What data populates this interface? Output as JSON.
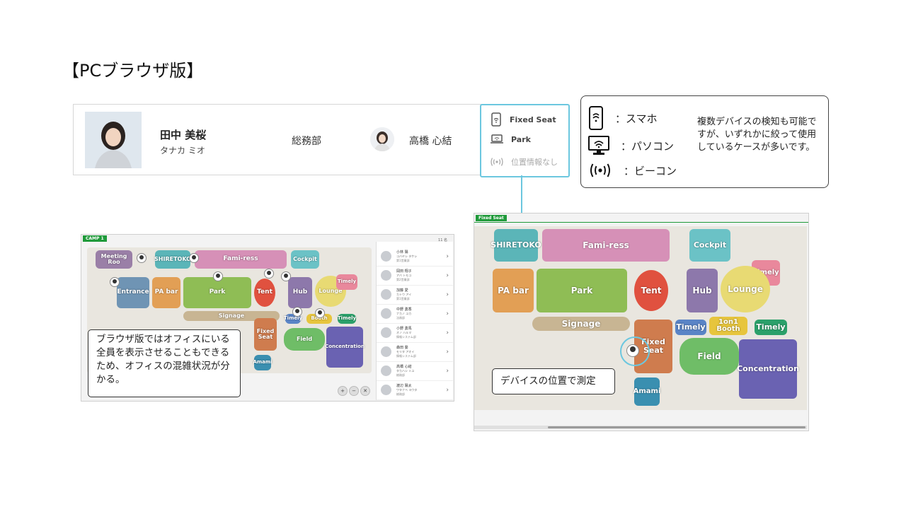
{
  "slide": {
    "title": "【PCブラウザ版】"
  },
  "profile": {
    "name": "田中 美桜",
    "kana": "タナカ ミオ",
    "department": "総務部",
    "colleague": "高橋 心結"
  },
  "status_legend": [
    {
      "icon": "smartphone-wifi-icon",
      "label": "Fixed Seat"
    },
    {
      "icon": "laptop-wifi-icon",
      "label": "Park"
    },
    {
      "icon": "beacon-icon",
      "label": "位置情報なし"
    }
  ],
  "device_legend": {
    "items": [
      {
        "icon": "smartphone-icon",
        "label": "：スマホ"
      },
      {
        "icon": "monitor-icon",
        "label": "：パソコン"
      },
      {
        "icon": "beacon-icon",
        "label": "：ビーコン"
      }
    ],
    "note": "複数デバイスの検知も可能ですが、いずれかに絞って使用しているケースが多いです。"
  },
  "left_map": {
    "tag": "CAMP 1",
    "zones": [
      "Meeting Roo",
      "SHIRETOKO",
      "Fami-ress",
      "Cockpit",
      "Entrance",
      "PA bar",
      "Park",
      "Tent",
      "Hub",
      "Lounge",
      "Timely",
      "Signage",
      "Timely",
      "Booth",
      "Timely",
      "Fixed Seat",
      "Field",
      "Concentration",
      "Amami"
    ],
    "list_header": "11 名",
    "people": [
      {
        "name": "小林 陽",
        "kana": "コバヤシ タケシ",
        "dept": "第1営業部"
      },
      {
        "name": "岡田 翔子",
        "kana": "アバ トモコ",
        "dept": "第2営業部"
      },
      {
        "name": "加藤 愛",
        "kana": "カトウ アイ",
        "dept": "第1営業部"
      },
      {
        "name": "中野 勇香",
        "kana": "ナカノ ユカ",
        "dept": "法務部"
      },
      {
        "name": "小野 勇馬",
        "kana": "オノ ハルマ",
        "dept": "情報システム部"
      },
      {
        "name": "森田 葵",
        "kana": "モリタ アオイ",
        "dept": "情報システム部"
      },
      {
        "name": "高橋 心結",
        "kana": "タカハシ ミユ",
        "dept": "総務部"
      },
      {
        "name": "渡辺 陽太",
        "kana": "ワタナベ ヨウタ",
        "dept": "総務部"
      }
    ],
    "callout": "ブラウザ版ではオフィスにいる全員を表示させることもできるため、オフィスの混雑状況が分かる。"
  },
  "right_map": {
    "tag": "Fixed Seat",
    "zones": [
      "SHIRETOKO",
      "Fami-ress",
      "Cockpit",
      "Timely",
      "PA bar",
      "Park",
      "Tent",
      "Hub",
      "Lounge",
      "Signage",
      "Timely",
      "1on1 Booth",
      "Timely",
      "Fixed Seat",
      "Field",
      "Concentration",
      "Amami"
    ],
    "callout": "デバイスの位置で測定"
  },
  "colors": {
    "accent": "#6cc7df",
    "green_tag": "#1f9a3a"
  }
}
